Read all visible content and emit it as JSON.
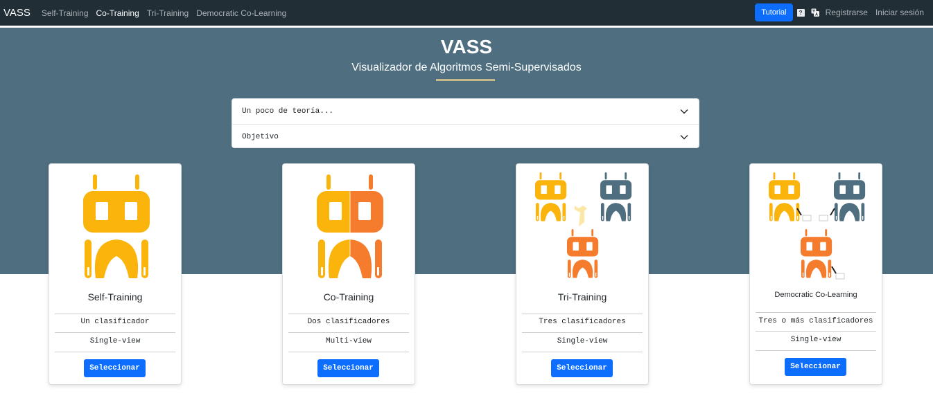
{
  "navbar": {
    "brand": "VASS",
    "links": [
      {
        "label": "Self-Training",
        "active": false
      },
      {
        "label": "Co-Training",
        "active": true
      },
      {
        "label": "Tri-Training",
        "active": false
      },
      {
        "label": "Democratic Co-Learning",
        "active": false
      }
    ],
    "tutorial_label": "Tutorial",
    "help_icon": "question-icon",
    "help_glyph": "?",
    "translate_icon": "translate-icon",
    "register_label": "Registrarse",
    "login_label": "Iniciar sesión"
  },
  "hero": {
    "title": "VASS",
    "subtitle": "Visualizador de Algoritmos Semi-Supervisados",
    "accent_color": "#c5b98c",
    "background_color": "#4f6f80"
  },
  "accordion": {
    "items": [
      {
        "label": "Un poco de teoría...",
        "icon": "chevron-down-icon"
      },
      {
        "label": "Objetivo",
        "icon": "chevron-down-icon"
      }
    ]
  },
  "cards": [
    {
      "title": "Self-Training",
      "classifiers": "Un clasificador",
      "view": "Single-view",
      "button": "Seleccionar",
      "illustration": "single-robot-yellow"
    },
    {
      "title": "Co-Training",
      "classifiers": "Dos clasificadores",
      "view": "Multi-view",
      "button": "Seleccionar",
      "illustration": "split-robot-yellow-orange"
    },
    {
      "title": "Tri-Training",
      "classifiers": "Tres clasificadores",
      "view": "Single-view",
      "button": "Seleccionar",
      "illustration": "three-robots"
    },
    {
      "title": "Democratic Co-Learning",
      "classifiers": "Tres o más clasificadores",
      "view": "Single-view",
      "button": "Seleccionar",
      "illustration": "three-robots-voting"
    }
  ],
  "colors": {
    "navbar": "#212e36",
    "primary": "#0d6efd",
    "robot_yellow": "#fbb40c",
    "robot_orange": "#f47c2c",
    "robot_slate": "#4f6f80"
  }
}
